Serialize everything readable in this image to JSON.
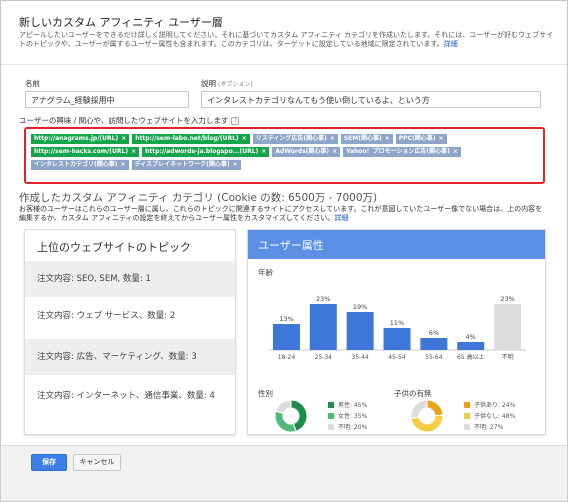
{
  "dialog": {
    "title": "新しいカスタム アフィニティ ユーザー層",
    "description": "アピールしたいユーザーをできるだけ詳しく説明してください。それに基づいてカスタム アフィニティ カテゴリを作成いたします。それには、ユーザーが好むウェブサイトのトピックや、ユーザーが属するユーザー属性も含まれます。このカテゴリは、ターゲットに設定している地域に限定されています。",
    "description_link": "詳細"
  },
  "form": {
    "name_label": "名前",
    "name_value": "アナグラム_経験採用中",
    "description_label": "説明",
    "description_optional": "(オプション)",
    "description_value": "インタレストカテゴリなんてもう使い倒しているよ、という方",
    "interests_label": "ユーザーの興味 / 関心や、訪問したウェブサイトを入力します",
    "help_icon": "?"
  },
  "tags": [
    {
      "label": "http://anagrams.jp/(URL)",
      "type": "url"
    },
    {
      "label": "http://sem-labo.net/blog/(URL)",
      "type": "url"
    },
    {
      "label": "リスティング広告(関心事)",
      "type": "interest"
    },
    {
      "label": "SEM(関心事)",
      "type": "interest"
    },
    {
      "label": "PPC(関心事)",
      "type": "interest"
    },
    {
      "label": "http://sem-hacks.com/(URL)",
      "type": "url"
    },
    {
      "label": "http://adwords-ja.blogspo...(URL)",
      "type": "url"
    },
    {
      "label": "AdWords(関心事)",
      "type": "interest"
    },
    {
      "label": "Yahoo！プロモーション広告(関心事)",
      "type": "interest"
    },
    {
      "label": "インタレストカテゴリ(関心事)",
      "type": "interest"
    },
    {
      "label": "ディスプレイネットワーク(関心事)",
      "type": "interest"
    }
  ],
  "summary": {
    "title": "作成したカスタム アフィニティ カテゴリ (Cookie の数: 6500万 - 7000万)",
    "text": "お客様のユーザーはこれらのユーザー層に属し、これらのトピックに関連するサイトにアクセスしています。これが意図していたユーザー像でない場合は、上の内容を編集するか、カスタム アフィニティの設定を終えてからユーザー属性をカスタマイズしてください。",
    "link": "詳細"
  },
  "topics": {
    "title": "上位のウェブサイトのトピック",
    "items": [
      "注文内容: SEO, SEM, 数量: 1",
      "注文内容: ウェブ サービス、数量: 2",
      "注文内容: 広告、マーケティング、数量: 3",
      "注文内容: インターネット、通信事業、数量: 4"
    ]
  },
  "demographics": {
    "title": "ユーザー属性",
    "age_label": "年齢",
    "gender_label": "性別",
    "kids_label": "子供の有無"
  },
  "chart_data": [
    {
      "type": "bar",
      "title": "年齢",
      "categories": [
        "18-24",
        "25-34",
        "35-44",
        "45-54",
        "55-64",
        "65 歳以上",
        "不明"
      ],
      "values": [
        13,
        23,
        19,
        11,
        6,
        4,
        23
      ],
      "value_labels": [
        "13%",
        "23%",
        "19%",
        "11%",
        "6%",
        "4%",
        "23%"
      ],
      "colors": [
        "#3d78d8",
        "#3d78d8",
        "#3d78d8",
        "#3d78d8",
        "#3d78d8",
        "#3d78d8",
        "#dddddd"
      ]
    },
    {
      "type": "pie",
      "title": "性別",
      "categories": [
        "男性",
        "女性",
        "不明"
      ],
      "values": [
        45,
        35,
        20
      ],
      "labels": [
        "男性: 45%",
        "女性: 35%",
        "不明: 20%"
      ],
      "colors": [
        "#1e8a4c",
        "#52b97d",
        "#dddddd"
      ]
    },
    {
      "type": "pie",
      "title": "子供の有無",
      "categories": [
        "子供あり",
        "子供なし",
        "不明"
      ],
      "values": [
        24,
        48,
        27
      ],
      "labels": [
        "子供あり: 24%",
        "子供なし: 48%",
        "不明: 27%"
      ],
      "colors": [
        "#e8a316",
        "#f5cc45",
        "#dddddd"
      ]
    }
  ],
  "footer": {
    "save_label": "保存",
    "cancel_label": "キャンセル"
  }
}
